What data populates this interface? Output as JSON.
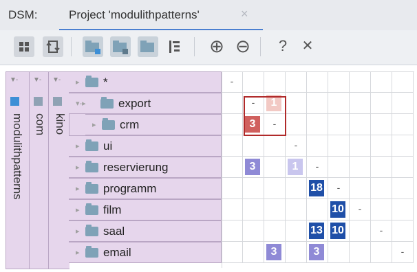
{
  "header": {
    "label": "DSM:",
    "tab_title": "Project 'modulithpatterns'",
    "close_glyph": "×"
  },
  "toolbar": {
    "icons": [
      "grid-icon",
      "refresh-icon",
      "package-icon",
      "package-icon",
      "package-icon",
      "hierarchy-icon",
      "plus-circle-icon",
      "minus-circle-icon",
      "help-icon",
      "close-icon"
    ],
    "plus": "⊕",
    "minus": "⊖",
    "help": "?",
    "close": "✕"
  },
  "tree": {
    "root": "modulithpatterns",
    "com": "com",
    "kino": "kino",
    "rows": [
      {
        "label": "*"
      },
      {
        "label": "export"
      },
      {
        "label": "crm"
      },
      {
        "label": "ui"
      },
      {
        "label": "reservierung"
      },
      {
        "label": "programm"
      },
      {
        "label": "film"
      },
      {
        "label": "saal"
      },
      {
        "label": "email"
      }
    ]
  },
  "matrix": {
    "dash": "-",
    "cells": [
      {
        "row": 0,
        "col": 0,
        "value": "-",
        "kind": "dash"
      },
      {
        "row": 1,
        "col": 1,
        "value": "-",
        "kind": "dash"
      },
      {
        "row": 1,
        "col": 2,
        "value": "1",
        "kind": "light-red"
      },
      {
        "row": 2,
        "col": 1,
        "value": "3",
        "kind": "red"
      },
      {
        "row": 2,
        "col": 2,
        "value": "-",
        "kind": "dash"
      },
      {
        "row": 3,
        "col": 3,
        "value": "-",
        "kind": "dash"
      },
      {
        "row": 4,
        "col": 1,
        "value": "3",
        "kind": "violet"
      },
      {
        "row": 4,
        "col": 3,
        "value": "1",
        "kind": "light-violet"
      },
      {
        "row": 4,
        "col": 4,
        "value": "-",
        "kind": "dash"
      },
      {
        "row": 5,
        "col": 4,
        "value": "18",
        "kind": "blue"
      },
      {
        "row": 5,
        "col": 5,
        "value": "-",
        "kind": "dash"
      },
      {
        "row": 6,
        "col": 5,
        "value": "10",
        "kind": "blue"
      },
      {
        "row": 6,
        "col": 6,
        "value": "-",
        "kind": "dash"
      },
      {
        "row": 7,
        "col": 4,
        "value": "13",
        "kind": "blue"
      },
      {
        "row": 7,
        "col": 5,
        "value": "10",
        "kind": "blue"
      },
      {
        "row": 7,
        "col": 7,
        "value": "-",
        "kind": "dash"
      },
      {
        "row": 8,
        "col": 2,
        "value": "3",
        "kind": "violet"
      },
      {
        "row": 8,
        "col": 4,
        "value": "3",
        "kind": "violet"
      },
      {
        "row": 8,
        "col": 8,
        "value": "-",
        "kind": "dash"
      }
    ],
    "colors": {
      "red": "#d0605e",
      "light-red": "#f2c9c4",
      "violet": "#8f8ad6",
      "light-violet": "#c9c6ee",
      "blue": "#1f4fa8"
    }
  }
}
